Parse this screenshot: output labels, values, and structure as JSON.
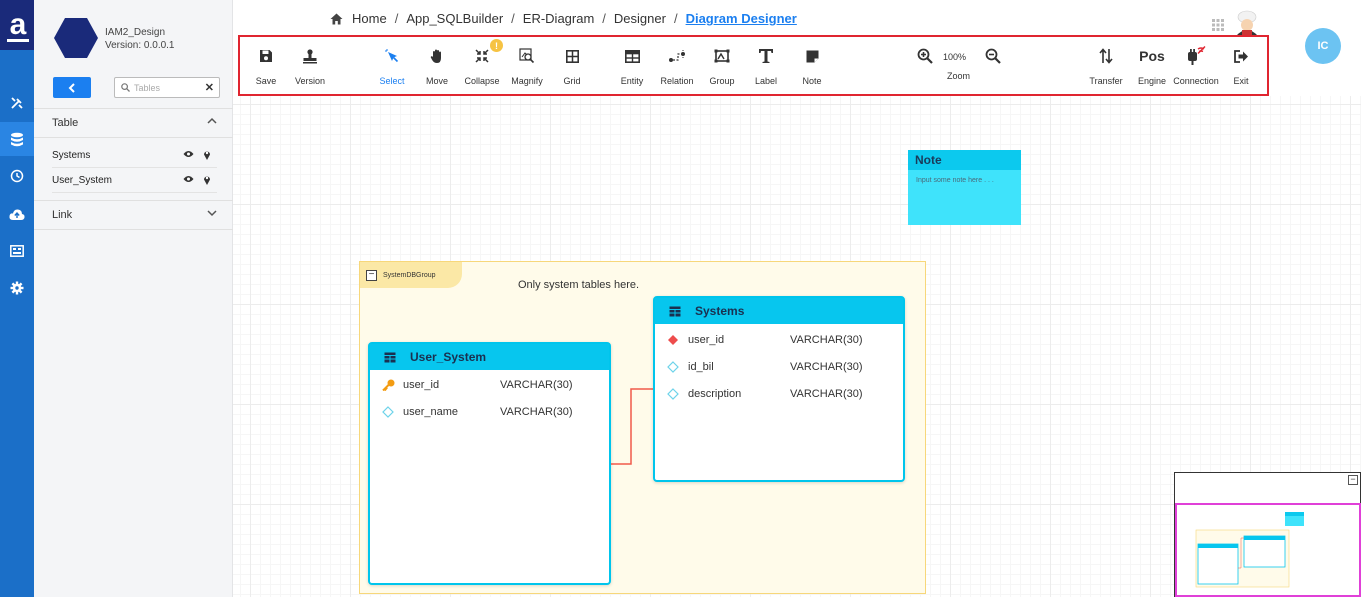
{
  "brand": {
    "logo_letter": "a"
  },
  "project": {
    "name": "IAM2_Design",
    "version": "Version: 0.0.0.1"
  },
  "sidebar": {
    "search_placeholder": "Tables",
    "table_section": "Table",
    "tables": [
      {
        "label": "Systems"
      },
      {
        "label": "User_System"
      }
    ],
    "link_section": "Link"
  },
  "breadcrumb": {
    "items": [
      "Home",
      "App_SQLBuilder",
      "ER-Diagram",
      "Designer"
    ],
    "current": "Diagram Designer",
    "separator": "/"
  },
  "user": {
    "initials": "IC"
  },
  "toolbar": {
    "save": "Save",
    "version": "Version",
    "select": "Select",
    "move": "Move",
    "collapse": "Collapse",
    "collapse_badge": "!",
    "magnify": "Magnify",
    "grid": "Grid",
    "entity": "Entity",
    "relation": "Relation",
    "group": "Group",
    "label": "Label",
    "note": "Note",
    "zoom_level": "100%",
    "zoom": "Zoom",
    "transfer": "Transfer",
    "engine_icon_text": "Pos",
    "engine": "Engine",
    "connection": "Connection",
    "exit": "Exit"
  },
  "canvas": {
    "note": {
      "title": "Note",
      "placeholder": "Input some note here . . ."
    },
    "group": {
      "name": "SystemDBGroup",
      "description": "Only system tables here."
    },
    "entities": [
      {
        "name": "User_System",
        "fields": [
          {
            "name": "user_id",
            "type": "VARCHAR(30)",
            "key": "primary"
          },
          {
            "name": "user_name",
            "type": "VARCHAR(30)",
            "key": "none"
          }
        ]
      },
      {
        "name": "Systems",
        "fields": [
          {
            "name": "user_id",
            "type": "VARCHAR(30)",
            "key": "foreign"
          },
          {
            "name": "id_bil",
            "type": "VARCHAR(30)",
            "key": "none"
          },
          {
            "name": "description",
            "type": "VARCHAR(30)",
            "key": "none"
          }
        ]
      }
    ]
  },
  "colors": {
    "rail": "#1b6fc8",
    "accent": "#1b7ff0",
    "entity_header": "#07c6ee",
    "toolbar_highlight": "#e02530",
    "relation_line": "#f05a4a",
    "group_bg": "#fffbea"
  }
}
